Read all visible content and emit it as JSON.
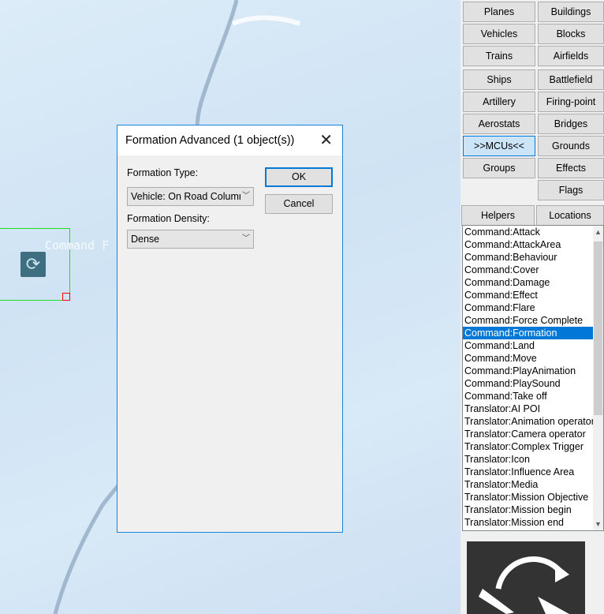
{
  "map": {
    "object_label": "Command F",
    "object_icon": "formation-command-icon"
  },
  "panel": {
    "category_buttons": [
      {
        "label": "Planes"
      },
      {
        "label": "Buildings"
      },
      {
        "label": "Vehicles"
      },
      {
        "label": "Blocks"
      },
      {
        "label": "Trains"
      },
      {
        "label": "Airfields"
      },
      {
        "label": "Ships"
      },
      {
        "label": "Battlefield"
      },
      {
        "label": "Artillery"
      },
      {
        "label": "Firing-point"
      },
      {
        "label": "Aerostats"
      },
      {
        "label": "Bridges"
      },
      {
        "label": ">>MCUs<<",
        "active": true
      },
      {
        "label": "Grounds"
      },
      {
        "label": "Groups"
      },
      {
        "label": "Effects"
      },
      {
        "label": "Flags"
      },
      {
        "label": "Helpers"
      },
      {
        "label": "Locations"
      }
    ],
    "list_items": [
      "Command:Attack",
      "Command:AttackArea",
      "Command:Behaviour",
      "Command:Cover",
      "Command:Damage",
      "Command:Effect",
      "Command:Flare",
      "Command:Force Complete",
      "Command:Formation",
      "Command:Land",
      "Command:Move",
      "Command:PlayAnimation",
      "Command:PlaySound",
      "Command:Take off",
      "Translator:AI POI",
      "Translator:Animation operator",
      "Translator:Camera operator",
      "Translator:Complex Trigger",
      "Translator:Icon",
      "Translator:Influence Area",
      "Translator:Media",
      "Translator:Mission Objective",
      "Translator:Mission begin",
      "Translator:Mission end"
    ],
    "selected_item": "Command:Formation"
  },
  "dialog": {
    "title": "Formation Advanced (1 object(s))",
    "formation_type_label": "Formation Type:",
    "formation_type_value": "Vehicle: On Road Column",
    "formation_density_label": "Formation Density:",
    "formation_density_value": "Dense",
    "ok_label": "OK",
    "cancel_label": "Cancel"
  },
  "colors": {
    "accent": "#0078d7",
    "selection_box": "#1fe01f"
  }
}
